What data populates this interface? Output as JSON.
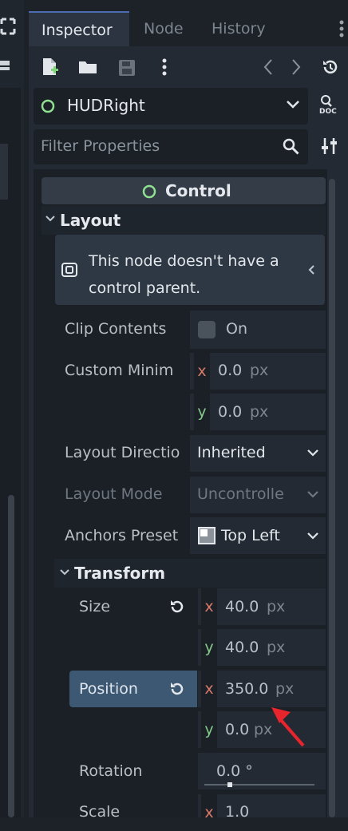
{
  "tabs": [
    "Inspector",
    "Node",
    "History"
  ],
  "node": {
    "name": "HUDRight",
    "doc_label": "DOC"
  },
  "filter": {
    "placeholder": "Filter Properties"
  },
  "section": {
    "title": "Control"
  },
  "layout": {
    "title": "Layout",
    "warning": [
      "This node doesn't have a",
      "control parent."
    ],
    "clip_contents": {
      "label": "Clip Contents",
      "value": "On"
    },
    "custom_min": {
      "label": "Custom Minim",
      "x": "0.0",
      "y": "0.0"
    },
    "layout_direction": {
      "label": "Layout Directio",
      "value": "Inherited"
    },
    "layout_mode": {
      "label": "Layout Mode",
      "value": "Uncontrolle"
    },
    "anchors_preset": {
      "label": "Anchors Preset",
      "value": "Top Left"
    }
  },
  "transform": {
    "title": "Transform",
    "size": {
      "label": "Size",
      "x": "40.0",
      "y": "40.0"
    },
    "position": {
      "label": "Position",
      "x": "350.0",
      "y": "0.0"
    },
    "rotation": {
      "label": "Rotation",
      "value": "0.0 °",
      "slider_fraction": 0.21
    },
    "scale": {
      "label": "Scale",
      "x": "1.0"
    }
  },
  "units": {
    "px": "px",
    "x": "x",
    "y": "y"
  },
  "colors": {
    "accent": "#4b6cb0",
    "node_ring": "#8fe08f",
    "highlight": "#3d5873",
    "arrow": "#e8242c"
  }
}
